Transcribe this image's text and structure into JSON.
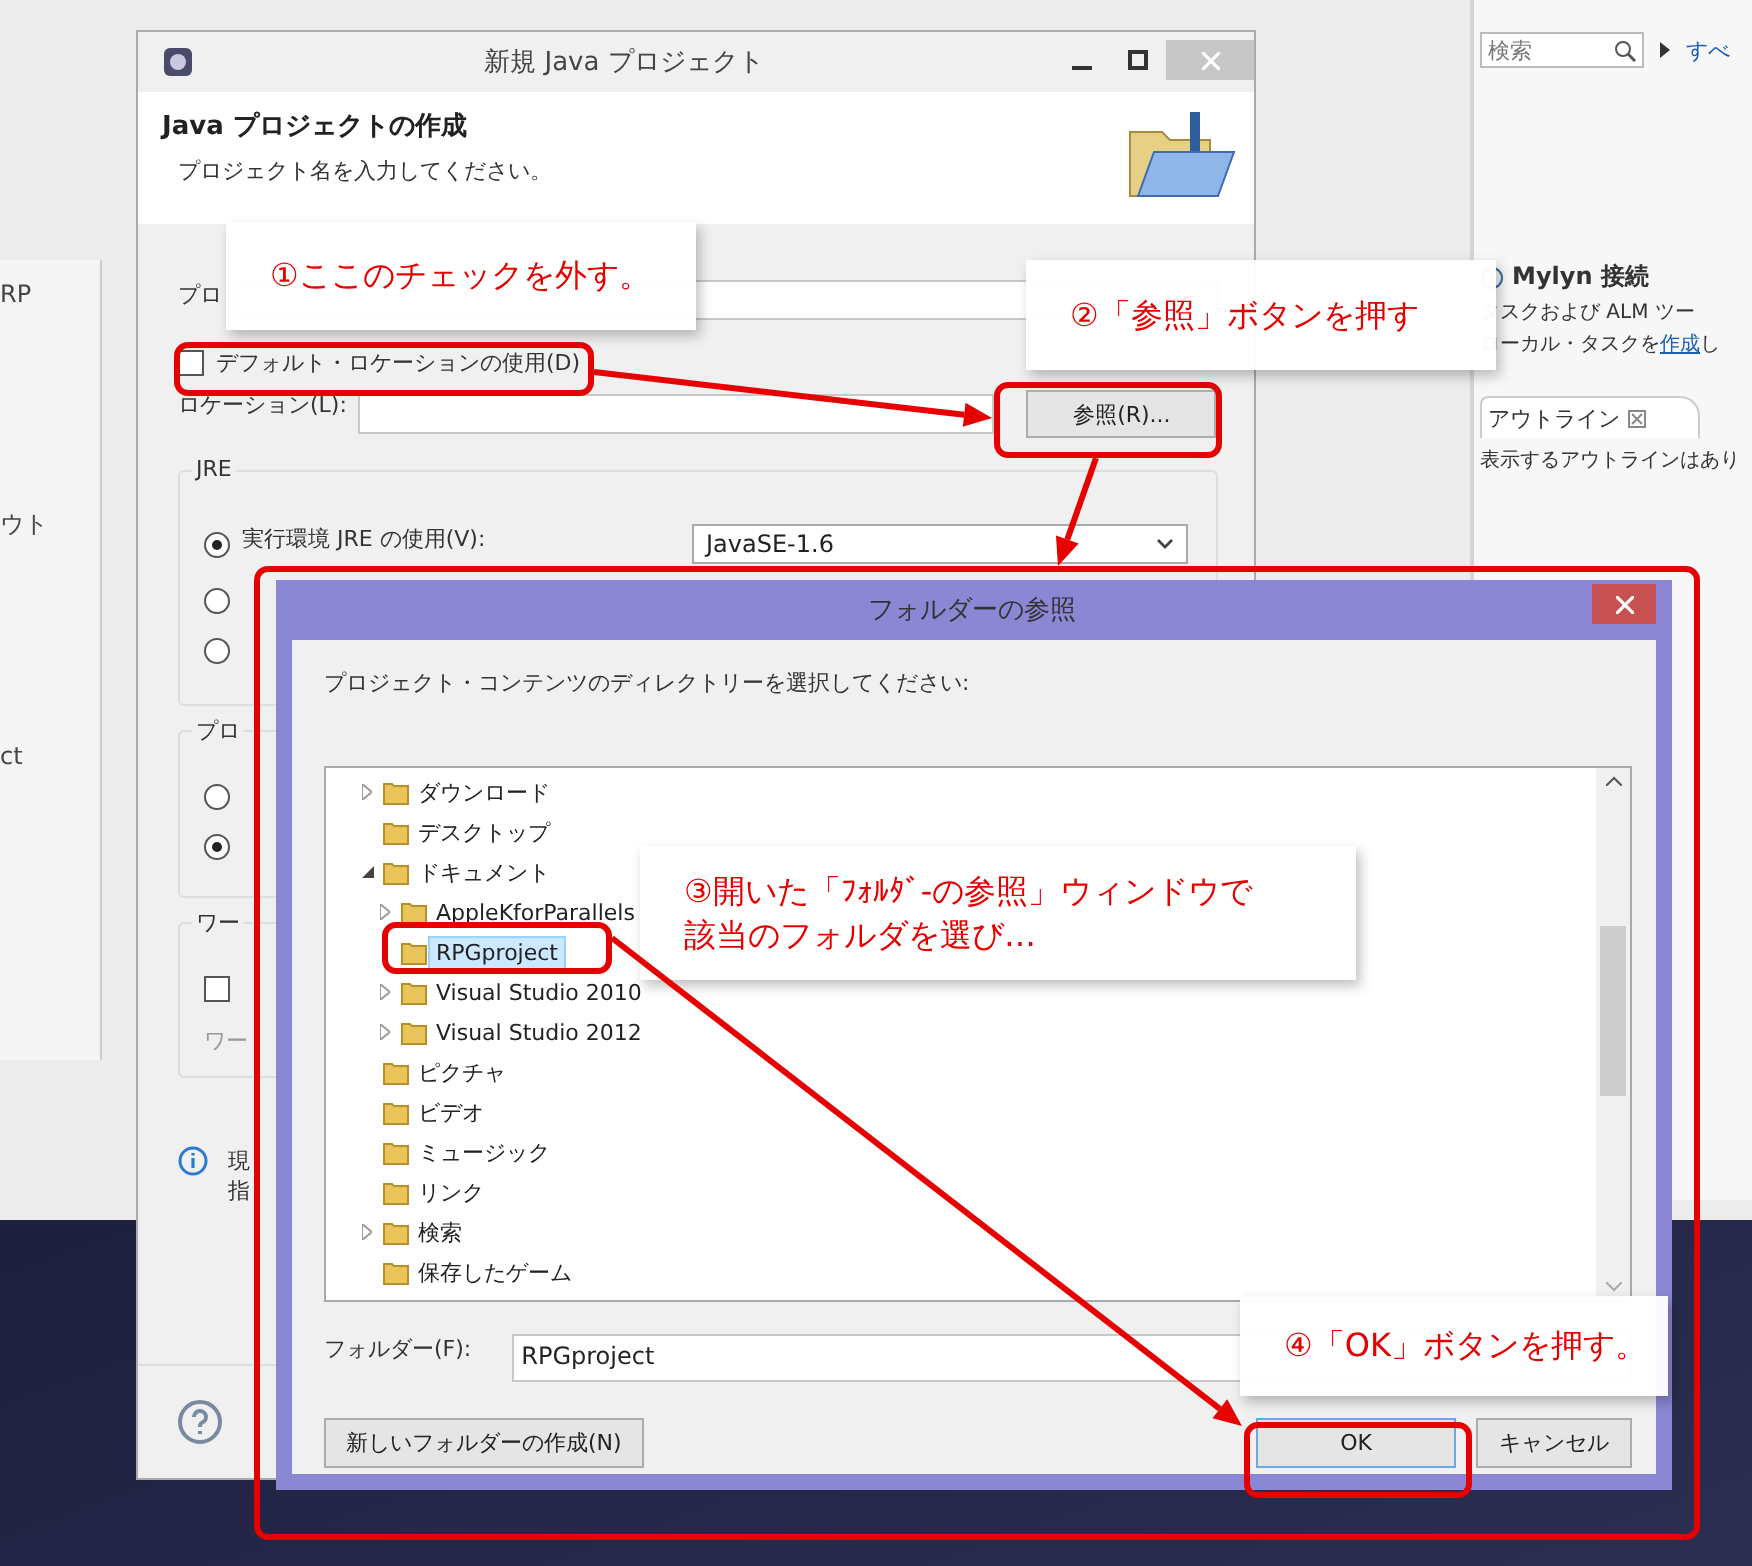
{
  "eclipse": {
    "left_fragments": [
      "RP",
      "ウト",
      "ct"
    ],
    "search": {
      "placeholder": "検索"
    },
    "all_link": "すべ",
    "mylyn": {
      "title": "Mylyn 接続",
      "line1": "タスクおよび ALM ツー",
      "line2_before": "ローカル・タスクを",
      "line2_link": "作成",
      "line2_after": "し"
    },
    "outline": {
      "tab": "アウトライン",
      "message": "表示するアウトラインはあり"
    }
  },
  "project_dialog": {
    "title": "新規 Java プロジェクト",
    "heading": "Java プロジェクトの作成",
    "subtitle": "プロジェクト名を入力してください。",
    "project_name_label": "プロ",
    "default_location": {
      "label": "デフォルト・ロケーションの使用(D)",
      "checked": false
    },
    "location_label": "ロケーション(L):",
    "browse_button": "参照(R)...",
    "jre": {
      "legend": "JRE",
      "environment": "JavaSE-1.6",
      "options": [
        {
          "label": "実行環境 JRE の使用(V):",
          "selected": true
        },
        {
          "selected": false
        },
        {
          "selected": false
        }
      ]
    },
    "layout": {
      "legend": "プロ",
      "options": [
        {
          "selected": false
        },
        {
          "selected": true
        }
      ]
    },
    "working_set": {
      "legend": "ワー",
      "checkbox": {
        "checked": false
      },
      "field_label": "ワー"
    },
    "info_lines": [
      "現",
      "指"
    ]
  },
  "browse_dialog": {
    "title": "フォルダーの参照",
    "instruction": "プロジェクト・コンテンツのディレクトリーを選択してください:",
    "tree": [
      {
        "label": "ダウンロード",
        "expanded": false,
        "selected": false
      },
      {
        "label": "デスクトップ",
        "selected": false
      },
      {
        "label": "ドキュメント",
        "expanded": true,
        "selected": false,
        "children": [
          {
            "label": "AppleKforParallels",
            "expanded": false,
            "selected": false
          },
          {
            "label": "RPGproject",
            "selected": true
          },
          {
            "label": "Visual Studio 2010",
            "expanded": false,
            "selected": false
          },
          {
            "label": "Visual Studio 2012",
            "expanded": false,
            "selected": false
          }
        ]
      },
      {
        "label": "ピクチャ",
        "selected": false
      },
      {
        "label": "ビデオ",
        "selected": false
      },
      {
        "label": "ミュージック",
        "selected": false
      },
      {
        "label": "リンク",
        "selected": false
      },
      {
        "label": "検索",
        "expanded": false,
        "selected": false
      },
      {
        "label": "保存したゲーム",
        "selected": false
      }
    ],
    "folder_label": "フォルダー(F):",
    "folder_value": "RPGproject",
    "new_folder_button": "新しいフォルダーの作成(N)",
    "ok_button": "OK",
    "cancel_button": "キャンセル"
  },
  "annotations": [
    {
      "lines": [
        "①ここのチェックを外す。"
      ]
    },
    {
      "lines": [
        "②「参照」ボタンを押す"
      ]
    },
    {
      "lines": [
        "③開いた「ﾌｫﾙﾀﾞ-の参照」ウィンドウで",
        "該当のフォルダを選び…"
      ]
    },
    {
      "lines": [
        "④「OK」ボタンを押す。"
      ]
    }
  ]
}
